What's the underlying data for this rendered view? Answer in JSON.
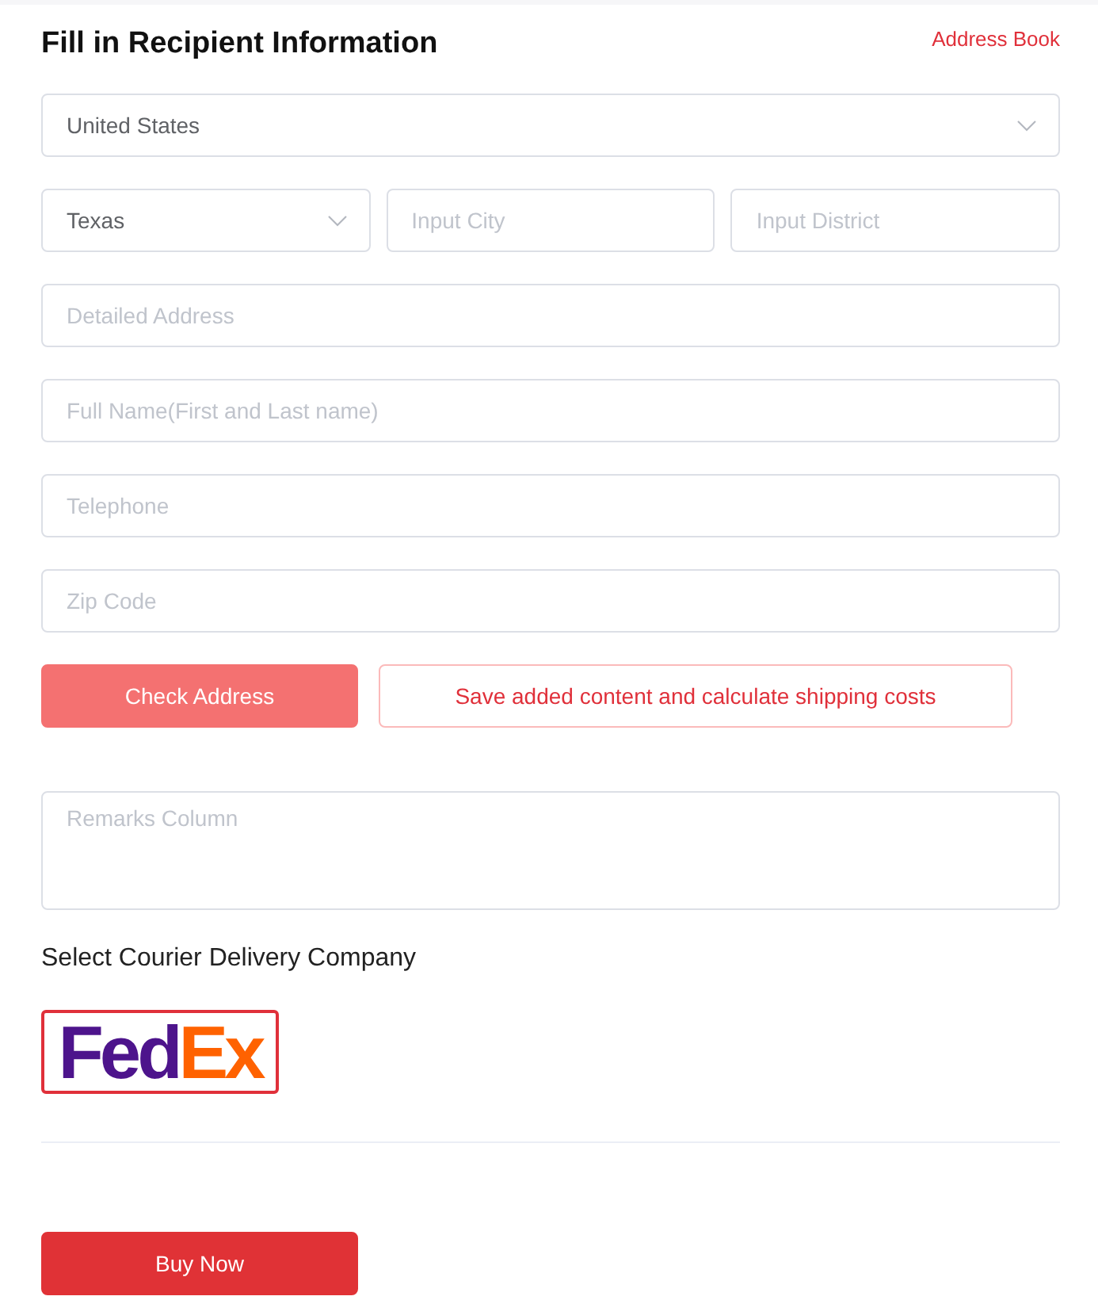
{
  "header": {
    "title": "Fill in Recipient Information",
    "address_book_link": "Address Book"
  },
  "address_rows": [
    {
      "fields": [
        {
          "kind": "select",
          "value": "United States"
        }
      ]
    },
    {
      "fields": [
        {
          "kind": "select",
          "value": "Texas"
        },
        {
          "kind": "input",
          "placeholder": "Input City"
        },
        {
          "kind": "input",
          "placeholder": "Input District"
        }
      ]
    },
    {
      "fields": [
        {
          "kind": "input",
          "placeholder": "Detailed Address"
        }
      ]
    },
    {
      "fields": [
        {
          "kind": "input",
          "placeholder": "Full Name(First and Last name)"
        }
      ]
    },
    {
      "fields": [
        {
          "kind": "input",
          "placeholder": "Telephone"
        }
      ]
    },
    {
      "fields": [
        {
          "kind": "input",
          "placeholder": "Zip Code"
        }
      ]
    }
  ],
  "actions": [
    {
      "kind": "filled",
      "label": "Check Address"
    },
    {
      "kind": "outline",
      "label": "Save added content and calculate shipping costs"
    }
  ],
  "remarks": {
    "placeholder": "Remarks Column"
  },
  "courier": {
    "label": "Select Courier Delivery Company",
    "options": [
      {
        "selected": true,
        "logo_parts": [
          {
            "text": "Fed",
            "color": "#4d148c"
          },
          {
            "text": "Ex",
            "color": "#ff6200"
          }
        ]
      }
    ]
  },
  "buy_button": {
    "label": "Buy Now"
  }
}
